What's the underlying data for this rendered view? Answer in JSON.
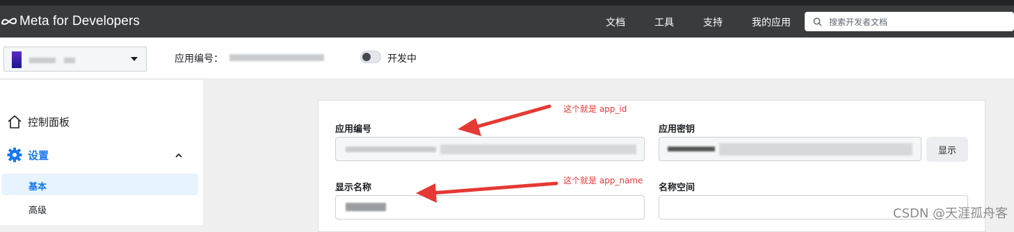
{
  "header": {
    "logo_text": "Meta for Developers",
    "nav": [
      "文档",
      "工具",
      "支持",
      "我的应用"
    ],
    "search_placeholder": "搜索开发者文档"
  },
  "appbar": {
    "app_id_label": "应用编号：",
    "mode_label": "开发中"
  },
  "sidebar": {
    "dashboard": "控制面板",
    "settings": "设置",
    "basic": "基本",
    "advanced": "高级"
  },
  "form": {
    "app_id_label": "应用编号",
    "app_secret_label": "应用密钥",
    "show_button": "显示",
    "display_name_label": "显示名称",
    "namespace_label": "名称空间"
  },
  "annotations": {
    "app_id_note": "这个就是 app_id",
    "app_name_note": "这个就是 app_name"
  },
  "watermark": "CSDN @天涯孤舟客",
  "colors": {
    "annotation": "#e53935",
    "accent": "#1877f2"
  }
}
